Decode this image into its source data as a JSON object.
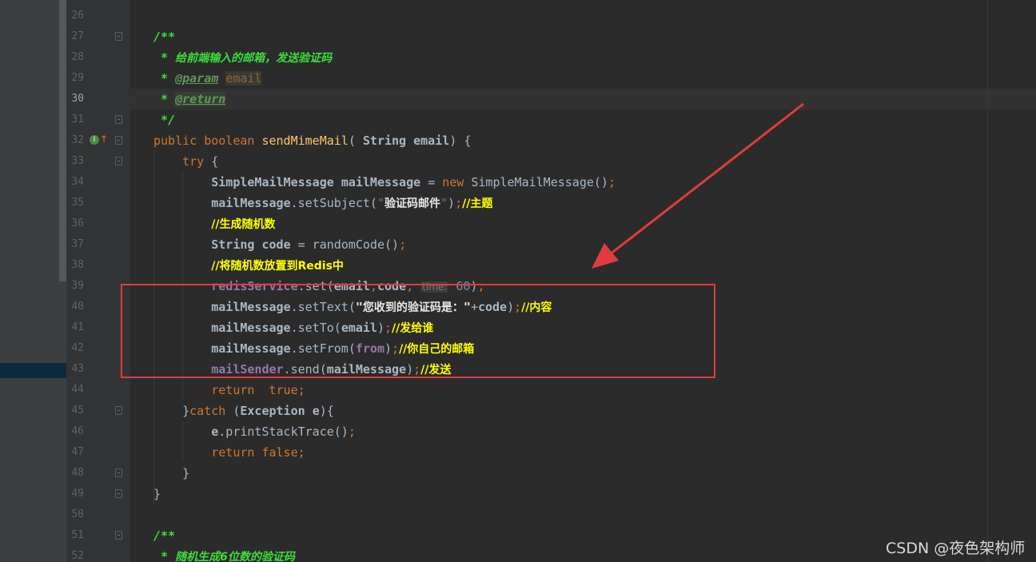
{
  "editor": {
    "lines": [
      {
        "n": "26",
        "html": ""
      },
      {
        "n": "27",
        "html": "<span class=\"doc\">/**</span>"
      },
      {
        "n": "28",
        "html": "<span class=\"doc\"> * </span><span class=\"doc-cjk\">给前端输入的邮箱，发送验证码</span>"
      },
      {
        "n": "29",
        "html": "<span class=\"doc\"> * </span><span class=\"doctag\">@param</span><span class=\"doc\"> </span><span class=\"docparam\">email</span>"
      },
      {
        "n": "30",
        "html": "<span class=\"doc\"> * </span><span class=\"docret\">@return</span>"
      },
      {
        "n": "31",
        "html": "<span class=\"doc\"> */</span>"
      },
      {
        "n": "32",
        "html": "<span class=\"kw\">public boolean </span><span class=\"fn\">sendMimeMail</span>( <span class=\"cls\">String </span><span class=\"var\">email</span>) {"
      },
      {
        "n": "33",
        "html": "    <span class=\"kw\">try </span>{"
      },
      {
        "n": "34",
        "html": "        <span class=\"cls\">SimpleMailMessage </span><span class=\"var\">mailMessage </span>= <span class=\"kw\">new </span>SimpleMailMessage()<span class=\"kw\">;</span>"
      },
      {
        "n": "35",
        "html": "        <span class=\"var\">mailMessage</span>.setSubject(<span class=\"str\">\"</span><span class=\"str\" style=\"font-family:'DejaVu Sans',sans-serif;font-size:14px;color:#e8e8e8;font-weight:bold\">验证码邮件</span><span class=\"str\">\"</span>)<span class=\"kw\">;</span><span class=\"cmt\">//主题</span>"
      },
      {
        "n": "36",
        "html": "        <span class=\"cmt\">//生成随机数</span>"
      },
      {
        "n": "37",
        "html": "        <span class=\"cls\">String </span><span class=\"var\">code </span>= randomCode()<span class=\"kw\">;</span>"
      },
      {
        "n": "38",
        "html": "        <span class=\"cmt\">//将随机数放置到Redis中</span>"
      },
      {
        "n": "39",
        "html": "        <span class=\"field\">redisService</span>.set(<span class=\"var\">email</span><span class=\"kw\">,</span><span class=\"var\">code</span><span class=\"kw\">, </span><span class=\"hint\">time:</span> <span class=\"num\">60</span>)<span class=\"kw\">;</span>"
      },
      {
        "n": "40",
        "html": "        <span class=\"var\">mailMessage</span>.setText(<span class=\"str\" style=\"color:#e8e8e8;font-weight:bold\">\"</span><span style=\"font-family:'DejaVu Sans',sans-serif;font-size:14px;color:#e8e8e8;font-weight:bold\">您收到的验证码是：</span><span class=\"str\" style=\"color:#e8e8e8;font-weight:bold\">\"</span>+<span class=\"var\">code</span>)<span class=\"kw\">;</span><span class=\"cmt\">//内容</span>"
      },
      {
        "n": "41",
        "html": "        <span class=\"var\">mailMessage</span>.setTo(<span class=\"var\">email</span>)<span class=\"kw\">;</span><span class=\"cmt\">//发给谁</span>"
      },
      {
        "n": "42",
        "html": "        <span class=\"var\">mailMessage</span>.setFrom(<span class=\"field\">from</span>)<span class=\"kw\">;</span><span class=\"cmt\">//你自己的邮箱</span>"
      },
      {
        "n": "43",
        "html": "        <span class=\"field\">mailSender</span>.send(<span class=\"var\">mailMessage</span>)<span class=\"kw\">;</span><span class=\"cmt\">//发送</span>"
      },
      {
        "n": "44",
        "html": "        <span class=\"kw\">return  true;</span>"
      },
      {
        "n": "45",
        "html": "    }<span class=\"kw\">catch </span>(<span class=\"cls\">Exception </span><span class=\"var\">e</span>){"
      },
      {
        "n": "46",
        "html": "        <span class=\"var\">e</span>.printStackTrace()<span class=\"kw\">;</span>"
      },
      {
        "n": "47",
        "html": "        <span class=\"kw\">return false;</span>"
      },
      {
        "n": "48",
        "html": "    }"
      },
      {
        "n": "49",
        "html": "}"
      },
      {
        "n": "50",
        "html": ""
      },
      {
        "n": "51",
        "html": "<span class=\"doc\">/**</span>"
      },
      {
        "n": "52",
        "html": "<span class=\"doc\"> * </span><span class=\"doc-cjk\">随机生成6位数的验证码</span>"
      }
    ],
    "folds": [
      "27",
      "31",
      "32",
      "33",
      "45",
      "48",
      "49",
      "51"
    ]
  },
  "watermark": "CSDN @夜色架构师",
  "colors": {
    "highlight_box": "#e23b3b",
    "arrow": "#e23b3b"
  }
}
